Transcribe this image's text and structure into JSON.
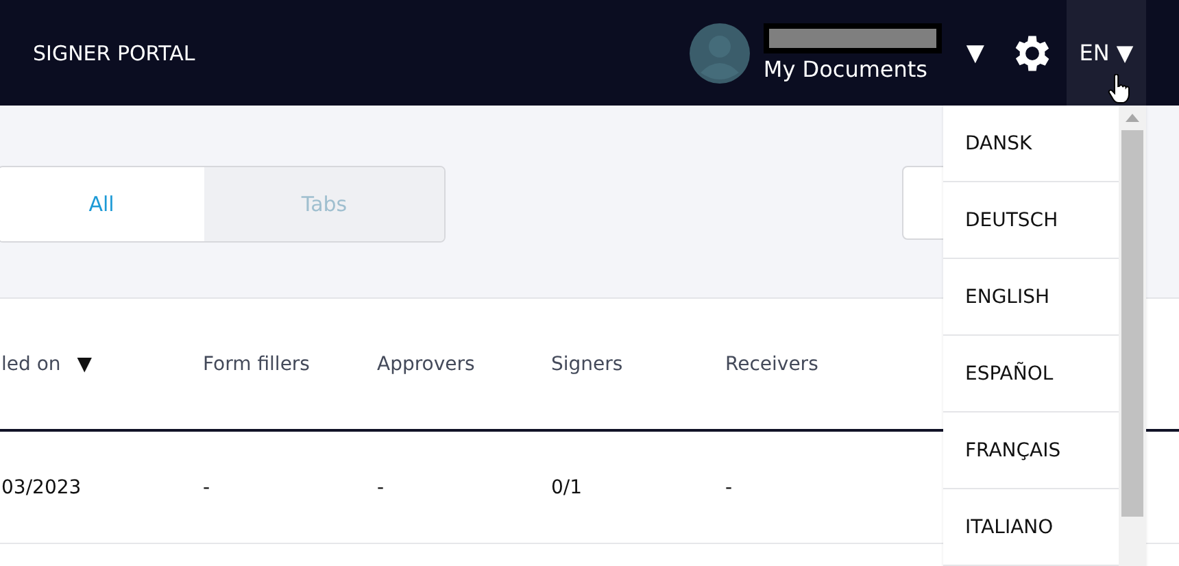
{
  "header": {
    "title": "SIGNER PORTAL",
    "account_label": "My Documents",
    "account_caret": "▼",
    "language": "EN",
    "language_caret": "▼"
  },
  "filter_tabs": [
    {
      "label": "All",
      "selected": true
    },
    {
      "label": "Tabs",
      "selected": false
    }
  ],
  "table": {
    "columns": [
      {
        "label": "led on",
        "sort": "▼"
      },
      {
        "label": "Form fillers"
      },
      {
        "label": "Approvers"
      },
      {
        "label": "Signers"
      },
      {
        "label": "Receivers"
      }
    ],
    "rows": [
      [
        "03/2023",
        "-",
        "-",
        "0/1",
        "-"
      ]
    ]
  },
  "language_menu": {
    "items": [
      "DANSK",
      "DEUTSCH",
      "ENGLISH",
      "ESPAÑOL",
      "FRANÇAIS",
      "ITALIANO"
    ]
  }
}
